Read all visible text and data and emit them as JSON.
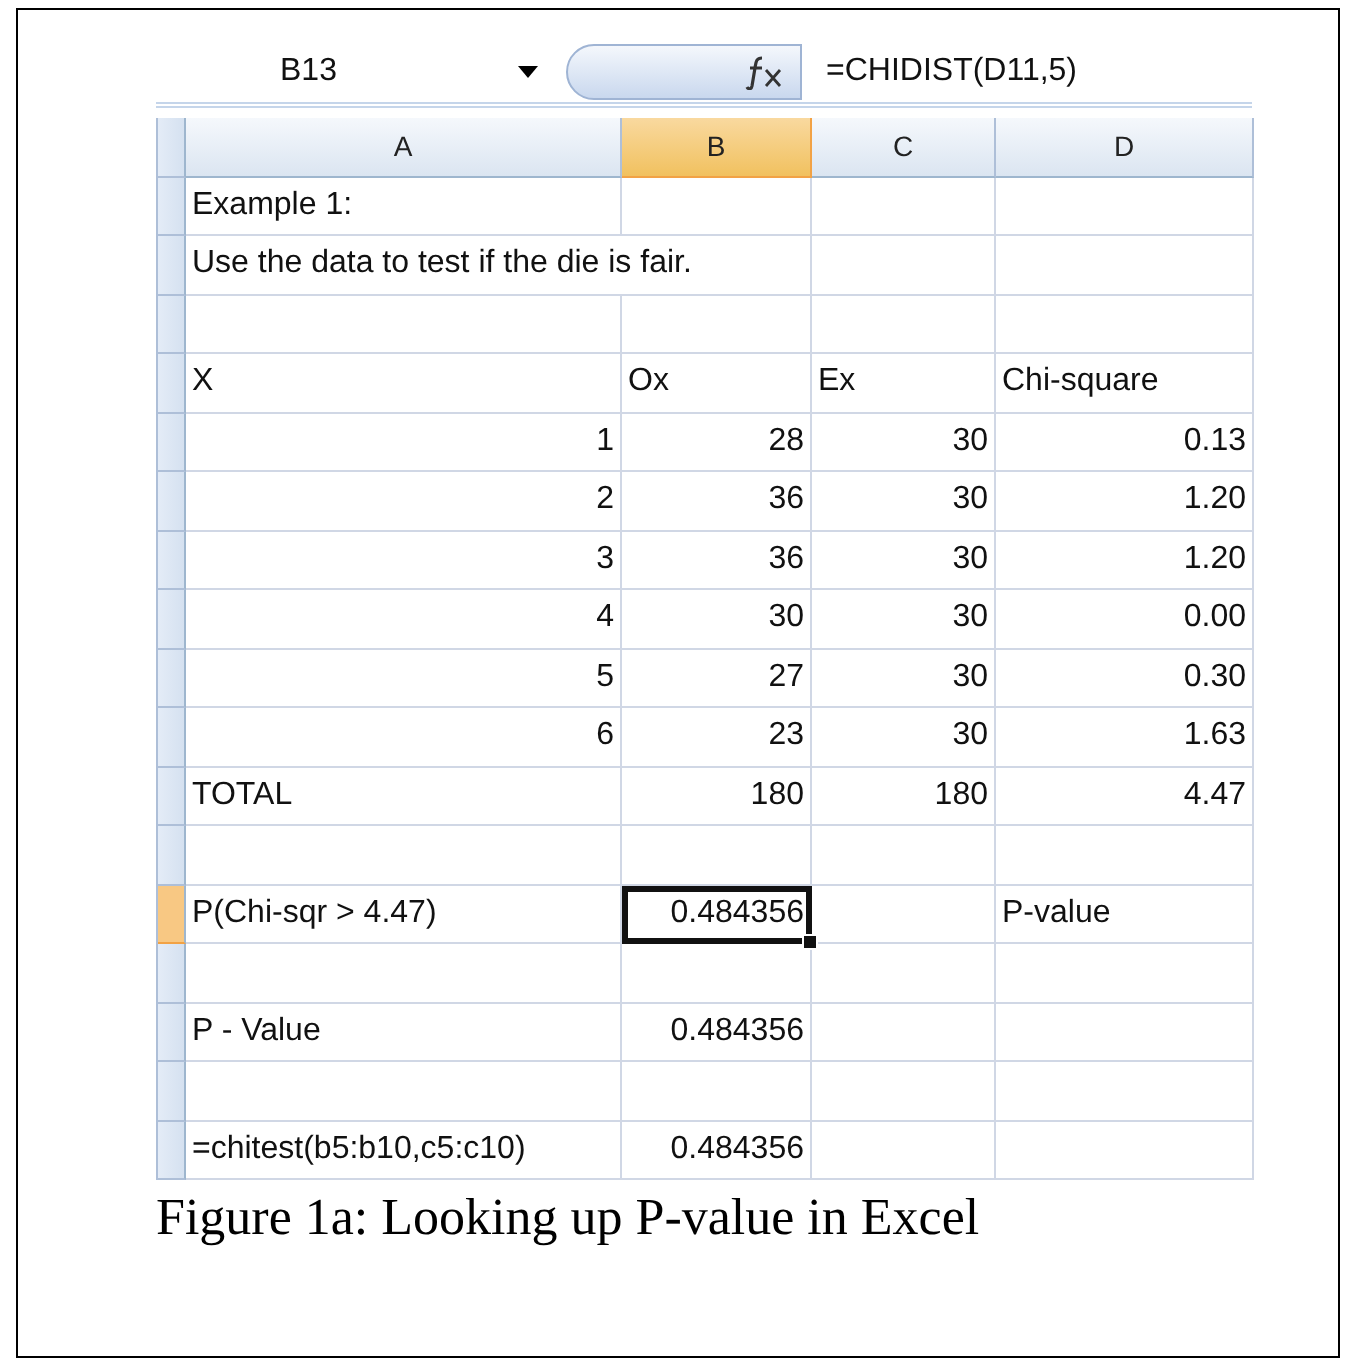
{
  "formula_bar": {
    "name_box": "B13",
    "formula": "=CHIDIST(D11,5)"
  },
  "columns": [
    {
      "label": "A",
      "selected": false
    },
    {
      "label": "B",
      "selected": true
    },
    {
      "label": "C",
      "selected": false
    },
    {
      "label": "D",
      "selected": false
    }
  ],
  "rows": [
    {
      "selected": false,
      "cells": [
        {
          "kind": "text",
          "text": "Example 1:"
        },
        null,
        null,
        null
      ]
    },
    {
      "selected": false,
      "cells": [
        {
          "kind": "text",
          "text": "Use the data to test if the die is fair."
        },
        null,
        null,
        null
      ]
    },
    {
      "selected": false,
      "cells": [
        null,
        null,
        null,
        null
      ]
    },
    {
      "selected": false,
      "cells": [
        {
          "kind": "text",
          "text": "X"
        },
        {
          "kind": "text",
          "text": "Ox"
        },
        {
          "kind": "text",
          "text": "Ex"
        },
        {
          "kind": "text",
          "text": "Chi-square"
        }
      ]
    },
    {
      "selected": false,
      "cells": [
        {
          "kind": "number",
          "text": "1"
        },
        {
          "kind": "number",
          "text": "28"
        },
        {
          "kind": "number",
          "text": "30"
        },
        {
          "kind": "number",
          "text": "0.13"
        }
      ]
    },
    {
      "selected": false,
      "cells": [
        {
          "kind": "number",
          "text": "2"
        },
        {
          "kind": "number",
          "text": "36"
        },
        {
          "kind": "number",
          "text": "30"
        },
        {
          "kind": "number",
          "text": "1.20"
        }
      ]
    },
    {
      "selected": false,
      "cells": [
        {
          "kind": "number",
          "text": "3"
        },
        {
          "kind": "number",
          "text": "36"
        },
        {
          "kind": "number",
          "text": "30"
        },
        {
          "kind": "number",
          "text": "1.20"
        }
      ]
    },
    {
      "selected": false,
      "cells": [
        {
          "kind": "number",
          "text": "4"
        },
        {
          "kind": "number",
          "text": "30"
        },
        {
          "kind": "number",
          "text": "30"
        },
        {
          "kind": "number",
          "text": "0.00"
        }
      ]
    },
    {
      "selected": false,
      "cells": [
        {
          "kind": "number",
          "text": "5"
        },
        {
          "kind": "number",
          "text": "27"
        },
        {
          "kind": "number",
          "text": "30"
        },
        {
          "kind": "number",
          "text": "0.30"
        }
      ]
    },
    {
      "selected": false,
      "cells": [
        {
          "kind": "number",
          "text": "6"
        },
        {
          "kind": "number",
          "text": "23"
        },
        {
          "kind": "number",
          "text": "30"
        },
        {
          "kind": "number",
          "text": "1.63"
        }
      ]
    },
    {
      "selected": false,
      "cells": [
        {
          "kind": "text",
          "text": "TOTAL"
        },
        {
          "kind": "number",
          "text": "180"
        },
        {
          "kind": "number",
          "text": "180"
        },
        {
          "kind": "number",
          "text": "4.47"
        }
      ]
    },
    {
      "selected": false,
      "cells": [
        null,
        null,
        null,
        null
      ]
    },
    {
      "selected": true,
      "cells": [
        {
          "kind": "text",
          "text": "P(Chi-sqr > 4.47)"
        },
        {
          "kind": "number",
          "text": "0.484356",
          "active": true
        },
        null,
        {
          "kind": "text",
          "text": "P-value"
        }
      ]
    },
    {
      "selected": false,
      "cells": [
        null,
        null,
        null,
        null
      ]
    },
    {
      "selected": false,
      "cells": [
        {
          "kind": "text",
          "text": "P - Value"
        },
        {
          "kind": "number",
          "text": "0.484356"
        },
        null,
        null
      ]
    },
    {
      "selected": false,
      "cells": [
        null,
        null,
        null,
        null
      ]
    },
    {
      "selected": false,
      "cells": [
        {
          "kind": "text",
          "text": "=chitest(b5:b10,c5:c10)"
        },
        {
          "kind": "number",
          "text": "0.484356"
        },
        null,
        null
      ]
    }
  ],
  "caption": "Figure 1a: Looking up P-value in Excel"
}
